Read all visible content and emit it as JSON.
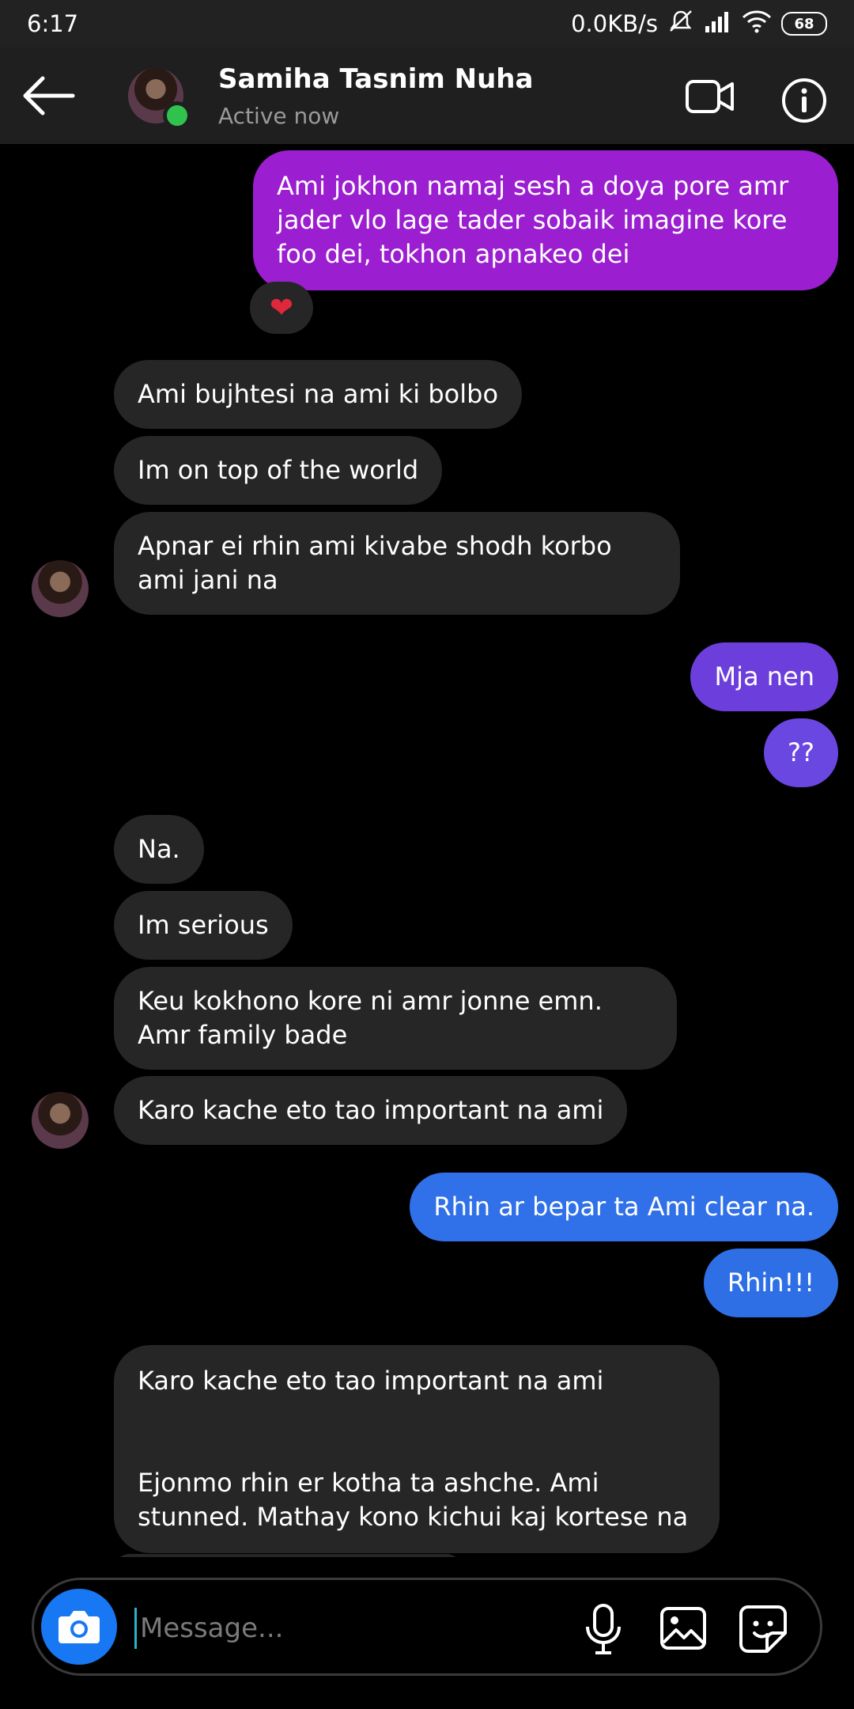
{
  "status_bar": {
    "time": "6:17",
    "network_speed": "0.0KB/s",
    "battery_level": "68",
    "icons": [
      "mute-icon",
      "signal-icon",
      "wifi-icon",
      "battery-icon"
    ]
  },
  "header": {
    "contact_name": "Samiha Tasnim Nuha",
    "contact_status": "Active now",
    "icons": [
      "back-arrow-icon",
      "video-call-icon",
      "info-icon"
    ],
    "online_color": "#31c24d"
  },
  "messages": [
    {
      "from": "me",
      "text": "Ami jokhon namaj sesh a doya pore amr jader vlo lage tader sobaik imagine kore foo dei, tokhon apnakeo dei",
      "reaction": "❤"
    },
    {
      "from": "them",
      "text": "Ami bujhtesi na ami ki bolbo"
    },
    {
      "from": "them",
      "text": "Im on top of the world"
    },
    {
      "from": "them",
      "text": "Apnar ei rhin ami kivabe shodh korbo ami jani na"
    },
    {
      "from": "me",
      "text": "Mja nen"
    },
    {
      "from": "me",
      "text": "??"
    },
    {
      "from": "them",
      "text": "Na."
    },
    {
      "from": "them",
      "text": "Im serious"
    },
    {
      "from": "them",
      "text": "Keu kokhono kore ni amr jonne emn. Amr family bade"
    },
    {
      "from": "them",
      "text": "Karo kache eto tao important na ami"
    },
    {
      "from": "me",
      "text": "Rhin ar bepar ta Ami clear na."
    },
    {
      "from": "me",
      "text": "Rhin!!!"
    },
    {
      "from": "them",
      "text": "Karo kache eto tao important na ami",
      "text2": "Ejonmo rhin er kotha ta ashche. Ami stunned. Mathay kono kichui kaj kortese na"
    }
  ],
  "composer": {
    "placeholder": "Message...",
    "icons": [
      "camera-icon",
      "microphone-icon",
      "gallery-icon",
      "sticker-icon"
    ]
  },
  "colors": {
    "sent_purple": "#9b1fd0",
    "sent_violet": "#6c3fdc",
    "sent_blue": "#2f6fe6",
    "received": "#262626",
    "camera_button": "#1877f2"
  }
}
